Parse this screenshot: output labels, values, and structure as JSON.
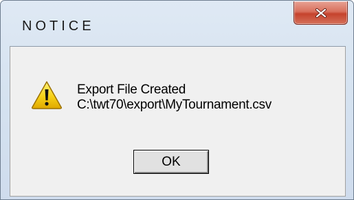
{
  "dialog": {
    "title": "NOTICE",
    "close_label": "X",
    "icon": "warning-icon",
    "message": {
      "line1": "Export File Created",
      "line2": "C:\\twt70\\export\\MyTournament.csv"
    },
    "ok_label": "OK"
  },
  "colors": {
    "close_button": "#c5432d",
    "warning_fill": "#f7d117"
  }
}
